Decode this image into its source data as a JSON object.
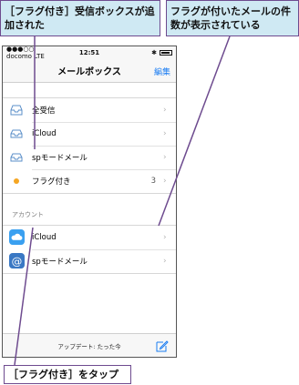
{
  "callouts": {
    "left": "［フラグ付き］受信ボックスが追加された",
    "right": "フラグが付いたメールの件数が表示されている",
    "bottom": "［フラグ付き］をタップ"
  },
  "statusbar": {
    "carrier": "●●●○○ docomo  LTE",
    "time": "12:51"
  },
  "navbar": {
    "title": "メールボックス",
    "edit_label": "編集"
  },
  "mailboxes": [
    {
      "label": "全受信",
      "icon": "inbox-icon",
      "count": ""
    },
    {
      "label": "iCloud",
      "icon": "mailbox-icon",
      "count": ""
    },
    {
      "label": "spモードメール",
      "icon": "mailbox-icon",
      "count": ""
    },
    {
      "label": "フラグ付き",
      "icon": "flag-dot-icon",
      "count": "3"
    }
  ],
  "accounts_header": "アカウント",
  "accounts": [
    {
      "label": "iCloud",
      "icon": "icloud-icon"
    },
    {
      "label": "spモードメール",
      "icon": "at-icon"
    }
  ],
  "toolbar": {
    "status": "アップデート: たった今"
  },
  "colors": {
    "accent": "#1a7cf2",
    "flag": "#f5a623",
    "callout_bg": "#cfe9f3",
    "callout_border": "#6e4b8f"
  }
}
